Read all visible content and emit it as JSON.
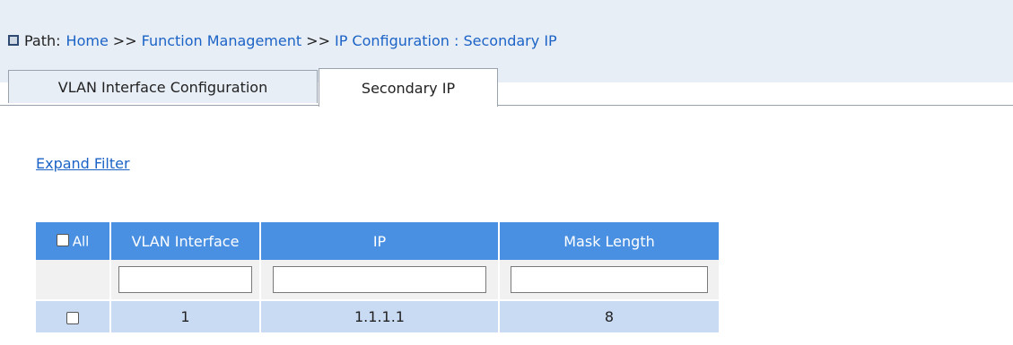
{
  "breadcrumb": {
    "label": "Path:",
    "items": [
      "Home",
      "Function Management",
      "IP Configuration : Secondary IP"
    ],
    "separator": ">>"
  },
  "tabs": [
    {
      "label": "VLAN Interface Configuration",
      "active": false
    },
    {
      "label": "Secondary IP",
      "active": true
    }
  ],
  "filter": {
    "expand_label": "Expand Filter"
  },
  "table": {
    "select_all_label": "All",
    "columns": [
      "VLAN Interface",
      "IP",
      "Mask Length"
    ],
    "rows": [
      {
        "vlan_interface": "1",
        "ip": "1.1.1.1",
        "mask_length": "8",
        "selected": false
      }
    ]
  },
  "colors": {
    "header_bg": "#4a90e2",
    "row_bg": "#c9daf3",
    "link": "#1b63c6"
  }
}
